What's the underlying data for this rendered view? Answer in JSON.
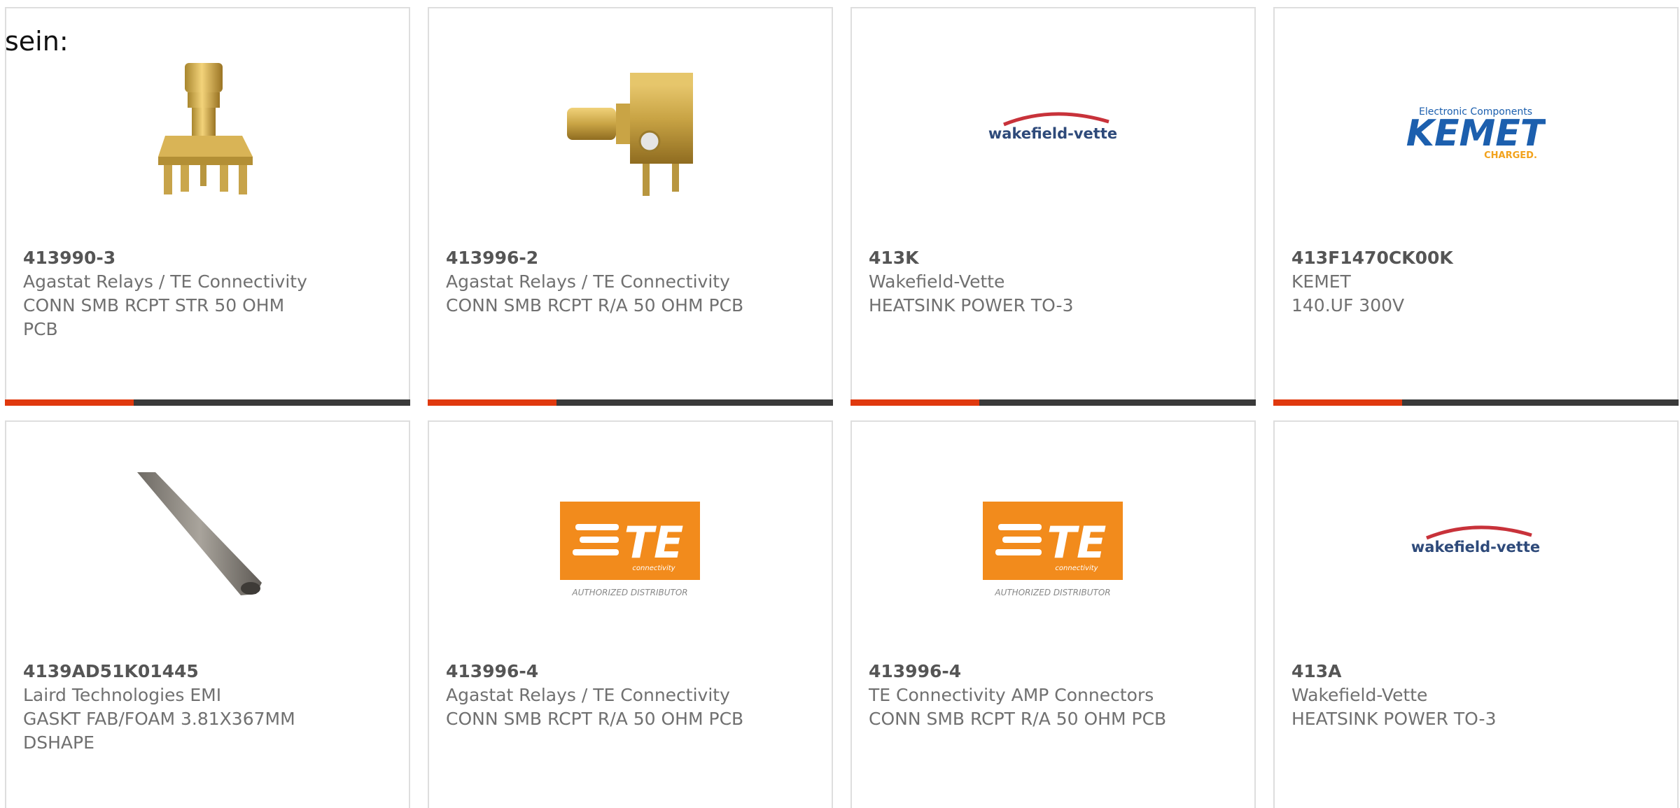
{
  "intro_text": "sein:",
  "colors": {
    "accent_bar": "#e0390e",
    "dark_bar": "#3a3a3a",
    "te_orange": "#f28b1c"
  },
  "products": [
    {
      "part_number": "413990-3",
      "manufacturer": "Agastat Relays / TE Connectivity",
      "description": "CONN SMB RCPT STR 50 OHM PCB",
      "image": "smb-straight-connector-image"
    },
    {
      "part_number": "413996-2",
      "manufacturer": "Agastat Relays / TE Connectivity",
      "description": "CONN SMB RCPT R/A 50 OHM PCB",
      "image": "smb-right-angle-connector-image"
    },
    {
      "part_number": "413K",
      "manufacturer": "Wakefield-Vette",
      "description": "HEATSINK POWER TO-3",
      "image": "wakefield-vette-logo",
      "logo_text": "wakefield-vette"
    },
    {
      "part_number": "413F1470CK00K",
      "manufacturer": "KEMET",
      "description": "140.UF 300V",
      "image": "kemet-logo",
      "logo_top": "Electronic Components",
      "logo_main": "KEMET",
      "logo_sub": "CHARGED."
    },
    {
      "part_number": "4139AD51K01445",
      "manufacturer": "Laird Technologies EMI",
      "description": "GASKT FAB/FOAM 3.81X367MM DSHAPE",
      "image": "gasket-strip-image"
    },
    {
      "part_number": "413996-4",
      "manufacturer": "Agastat Relays / TE Connectivity",
      "description": "CONN SMB RCPT R/A 50 OHM PCB",
      "image": "te-connectivity-logo",
      "logo_main": "TE",
      "logo_small": "connectivity",
      "logo_caption": "AUTHORIZED DISTRIBUTOR"
    },
    {
      "part_number": "413996-4",
      "manufacturer": "TE Connectivity AMP Connectors",
      "description": "CONN SMB RCPT R/A 50 OHM PCB",
      "image": "te-connectivity-logo",
      "logo_main": "TE",
      "logo_small": "connectivity",
      "logo_caption": "AUTHORIZED DISTRIBUTOR"
    },
    {
      "part_number": "413A",
      "manufacturer": "Wakefield-Vette",
      "description": "HEATSINK POWER TO-3",
      "image": "wakefield-vette-logo",
      "logo_text": "wakefield-vette"
    }
  ]
}
